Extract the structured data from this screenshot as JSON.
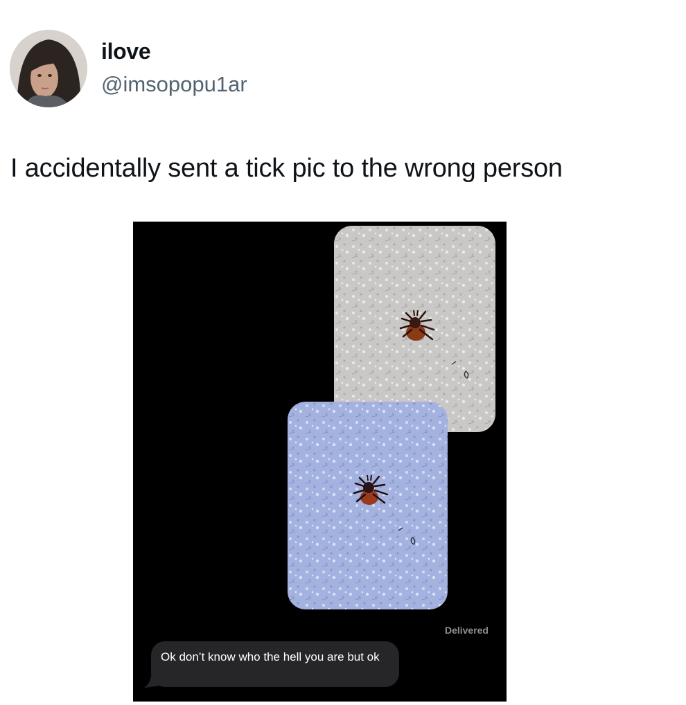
{
  "tweet": {
    "display_name": "ilove",
    "handle": "@imsopopu1ar",
    "text": "I accidentally sent a tick pic to the wrong person",
    "avatar_icon": "profile-photo"
  },
  "screenshot": {
    "background_color": "#000000",
    "images": [
      {
        "description_icon": "tick-photo-grey"
      },
      {
        "description_icon": "tick-photo-blue"
      }
    ],
    "status": "Delivered",
    "reply": {
      "text": "Ok don’t know who the hell you are but ok",
      "bubble_color": "#262628"
    }
  },
  "colors": {
    "text_primary": "#0f1419",
    "text_secondary": "#536471"
  }
}
